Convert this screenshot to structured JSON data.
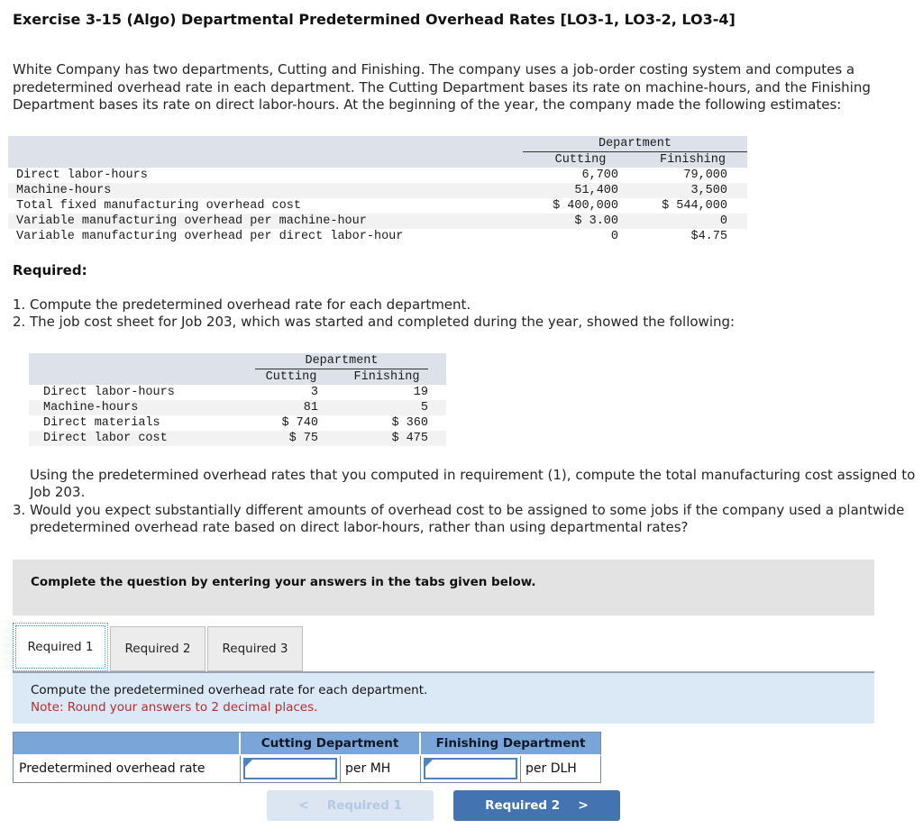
{
  "colors": {
    "accent_input_blue": "#4f81bd",
    "answer_header_blue": "#7aa5d8",
    "estimates_header_bg": "#dde1ea",
    "panel_blue_bg": "#dbe8f6",
    "note_red": "#b03030",
    "next_button_blue": "#4373b0",
    "prev_button_gray_blue": "#dce6f2",
    "banner_gray": "#e3e3e3"
  },
  "header": {
    "title": "Exercise 3-15 (Algo) Departmental Predetermined Overhead Rates [LO3-1, LO3-2, LO3-4]"
  },
  "intro": {
    "line1": "White Company has two departments, Cutting and Finishing. The company uses a job-order costing system and computes a",
    "line2": "predetermined overhead rate in each department. The Cutting Department bases its rate on machine-hours, and the Finishing",
    "line3": "Department bases its rate on direct labor-hours. At the beginning of the year, the company made the following estimates:"
  },
  "estimates_table": {
    "group_header": "Department",
    "col1": "Cutting",
    "col2": "Finishing",
    "rows": [
      {
        "label": "Direct labor-hours",
        "cutting": "6,700",
        "finishing": "79,000"
      },
      {
        "label": "Machine-hours",
        "cutting": "51,400",
        "finishing": "3,500"
      },
      {
        "label": "Total fixed manufacturing overhead cost",
        "cutting": "$ 400,000",
        "finishing": "$ 544,000"
      },
      {
        "label": "Variable manufacturing overhead per machine-hour",
        "cutting": "$ 3.00",
        "finishing": "0"
      },
      {
        "label": "Variable manufacturing overhead per direct labor-hour",
        "cutting": "0",
        "finishing": "$4.75"
      }
    ]
  },
  "required": {
    "heading": "Required:",
    "item1_num": "1.",
    "item1_text": "Compute the predetermined overhead rate for each department.",
    "item2_num": "2.",
    "item2_text": "The job cost sheet for Job 203, which was started and completed during the year, showed the following:",
    "item2_cont_line1": "Using the predetermined overhead rates that you computed in requirement (1), compute the total manufacturing cost assigned to",
    "item2_cont_line2": "Job 203.",
    "item3_num": "3.",
    "item3_line1": "Would you expect substantially different amounts of overhead cost to be assigned to some jobs if the company used a plantwide",
    "item3_line2": "predetermined overhead rate based on direct labor-hours, rather than using departmental rates?"
  },
  "job_table": {
    "group_header": "Department",
    "col1": "Cutting",
    "col2": "Finishing",
    "rows": [
      {
        "label": "Direct labor-hours",
        "cutting": "3",
        "finishing": "19"
      },
      {
        "label": "Machine-hours",
        "cutting": "81",
        "finishing": "5"
      },
      {
        "label": "Direct materials",
        "cutting": "$ 740",
        "finishing": "$ 360"
      },
      {
        "label": "Direct labor cost",
        "cutting": "$ 75",
        "finishing": "$ 475"
      }
    ]
  },
  "widget": {
    "banner_text": "Complete the question by entering your answers in the tabs given below.",
    "tabs": [
      {
        "label": "Required 1"
      },
      {
        "label": "Required 2"
      },
      {
        "label": "Required 3"
      }
    ],
    "panel": {
      "prompt": "Compute the predetermined overhead rate for each department.",
      "note": "Note: Round your answers to 2 decimal places."
    },
    "answer_table": {
      "col1_header": "Cutting Department",
      "col2_header": "Finishing Department",
      "row_label": "Predetermined overhead rate",
      "cutting_input_value": "",
      "cutting_unit": "per MH",
      "finishing_input_value": "",
      "finishing_unit": "per DLH"
    },
    "buttons": {
      "prev_chevron": "<",
      "prev_label": "Required 1",
      "next_label": "Required 2",
      "next_chevron": ">"
    }
  }
}
